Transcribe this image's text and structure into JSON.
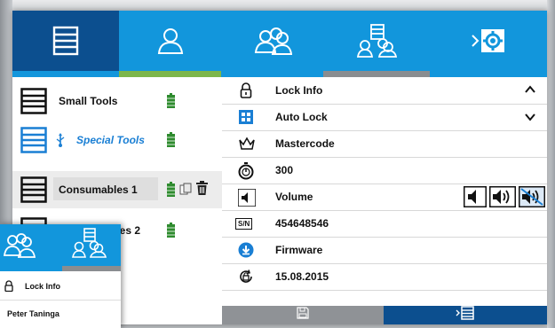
{
  "colors": {
    "primary": "#1296dc",
    "primary_dark": "#0c4f8f",
    "green": "#7db64a",
    "gray": "#8a8d90",
    "battery": "#2e8b2e"
  },
  "top_tabs": [
    {
      "name": "storage",
      "icon": "cabinet-icon",
      "active": true
    },
    {
      "name": "user",
      "icon": "user-icon"
    },
    {
      "name": "groups",
      "icon": "users-group-icon"
    },
    {
      "name": "assignments",
      "icon": "user-cabinet-icon"
    },
    {
      "name": "settings",
      "icon": "settings-gear-icon"
    }
  ],
  "storage_list": [
    {
      "label": "Small Tools",
      "battery": "battery-full-icon"
    },
    {
      "label": "Special Tools",
      "usb": true,
      "battery": "battery-full-icon"
    },
    {
      "label": "Consumables 1",
      "selected": true,
      "battery": "battery-full-icon"
    },
    {
      "label": "Comsumables 2",
      "battery": "battery-full-icon"
    }
  ],
  "details": {
    "lock_info": "Lock Info",
    "auto_lock": "Auto Lock",
    "mastercode": "Mastercode",
    "timer_value": "300",
    "volume": "Volume",
    "serial_label": "S/N",
    "serial_value": "454648546",
    "firmware": "Firmware",
    "date": "15.08.2015"
  },
  "overlay": {
    "lock_info": "Lock Info",
    "user": "Peter Taninga"
  }
}
